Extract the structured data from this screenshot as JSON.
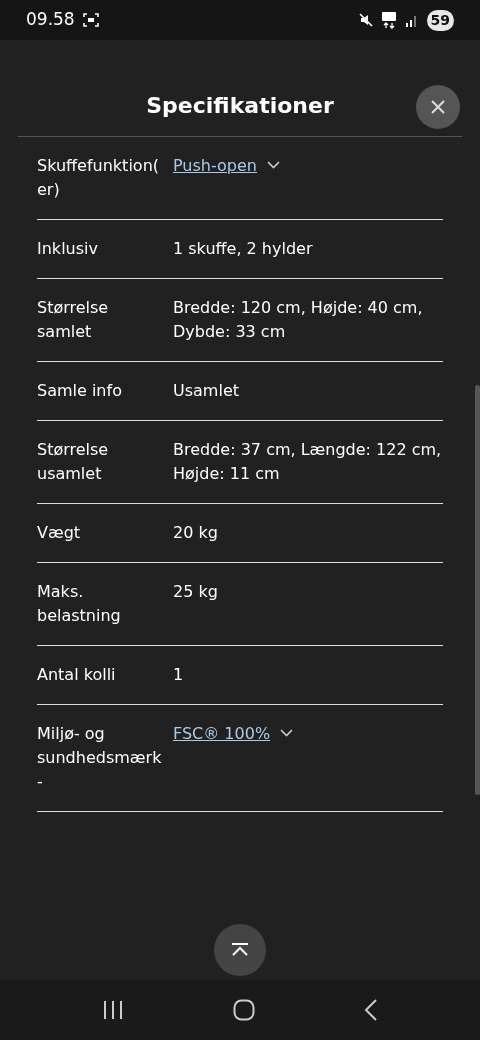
{
  "status_bar": {
    "time": "09.58",
    "battery": "59"
  },
  "title": "Specifikationer",
  "specs": [
    {
      "label": "Skuffefunktion(er)",
      "value": "Push-open",
      "kind": "link"
    },
    {
      "label": "Inklusiv",
      "value": "1 skuffe, 2 hylder",
      "kind": "text"
    },
    {
      "label": "Størrelse samlet",
      "value": "Bredde: 120 cm, Højde: 40 cm, Dybde: 33 cm",
      "kind": "text"
    },
    {
      "label": "Samle info",
      "value": "Usamlet",
      "kind": "text"
    },
    {
      "label": "Størrelse usamlet",
      "value": "Bredde: 37 cm, Længde: 122 cm, Højde: 11 cm",
      "kind": "text"
    },
    {
      "label": "Vægt",
      "value": "20 kg",
      "kind": "text"
    },
    {
      "label": "Maks. belastning",
      "value": "25 kg",
      "kind": "text"
    },
    {
      "label": "Antal kolli",
      "value": "1",
      "kind": "text"
    },
    {
      "label": "Miljø- og sundhedsmærk-",
      "value": "FSC® 100%",
      "kind": "link"
    }
  ]
}
